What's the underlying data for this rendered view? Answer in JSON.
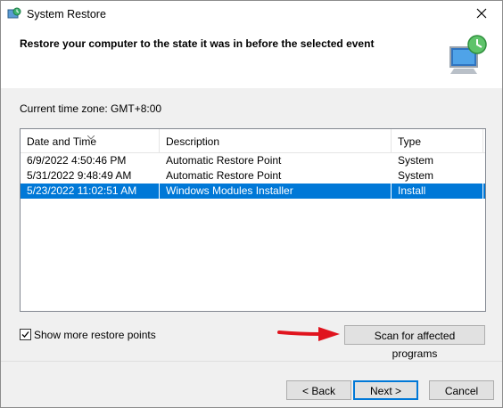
{
  "window": {
    "title": "System Restore"
  },
  "header": {
    "title": "Restore your computer to the state it was in before the selected event"
  },
  "timezone_label": "Current time zone: GMT+8:00",
  "list": {
    "columns": [
      "Date and Time",
      "Description",
      "Type"
    ],
    "rows": [
      {
        "date": "6/9/2022 4:50:46 PM",
        "description": "Automatic Restore Point",
        "type": "System",
        "selected": false
      },
      {
        "date": "5/31/2022 9:48:49 AM",
        "description": "Automatic Restore Point",
        "type": "System",
        "selected": false
      },
      {
        "date": "5/23/2022 11:02:51 AM",
        "description": "Windows Modules Installer",
        "type": "Install",
        "selected": true
      }
    ]
  },
  "show_more": {
    "label": "Show more restore points",
    "checked": true
  },
  "buttons": {
    "scan": "Scan for affected programs",
    "back": "< Back",
    "next": "Next >",
    "cancel": "Cancel"
  },
  "colors": {
    "selection": "#0078d7",
    "annotation_arrow": "#e0141e"
  }
}
